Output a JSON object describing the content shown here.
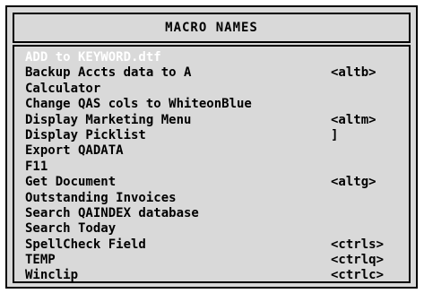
{
  "dialog": {
    "title": "MACRO NAMES"
  },
  "macros": [
    {
      "name": "ADD to KEYWORD.dtf",
      "shortcut": "",
      "selected": true
    },
    {
      "name": "Backup Accts data to A",
      "shortcut": "<altb>"
    },
    {
      "name": "Calculator",
      "shortcut": ""
    },
    {
      "name": "Change QAS cols to WhiteonBlue",
      "shortcut": ""
    },
    {
      "name": "Display Marketing Menu",
      "shortcut": "<altm>"
    },
    {
      "name": "Display Picklist",
      "shortcut": "]"
    },
    {
      "name": "Export QADATA",
      "shortcut": ""
    },
    {
      "name": "F11",
      "shortcut": ""
    },
    {
      "name": "Get Document",
      "shortcut": "<altg>"
    },
    {
      "name": "Outstanding Invoices",
      "shortcut": ""
    },
    {
      "name": "Search QAINDEX database",
      "shortcut": ""
    },
    {
      "name": "Search Today",
      "shortcut": ""
    },
    {
      "name": "SpellCheck Field",
      "shortcut": "<ctrls>"
    },
    {
      "name": "TEMP",
      "shortcut": "<ctrlq>"
    },
    {
      "name": "Winclip",
      "shortcut": "<ctrlc>"
    }
  ]
}
